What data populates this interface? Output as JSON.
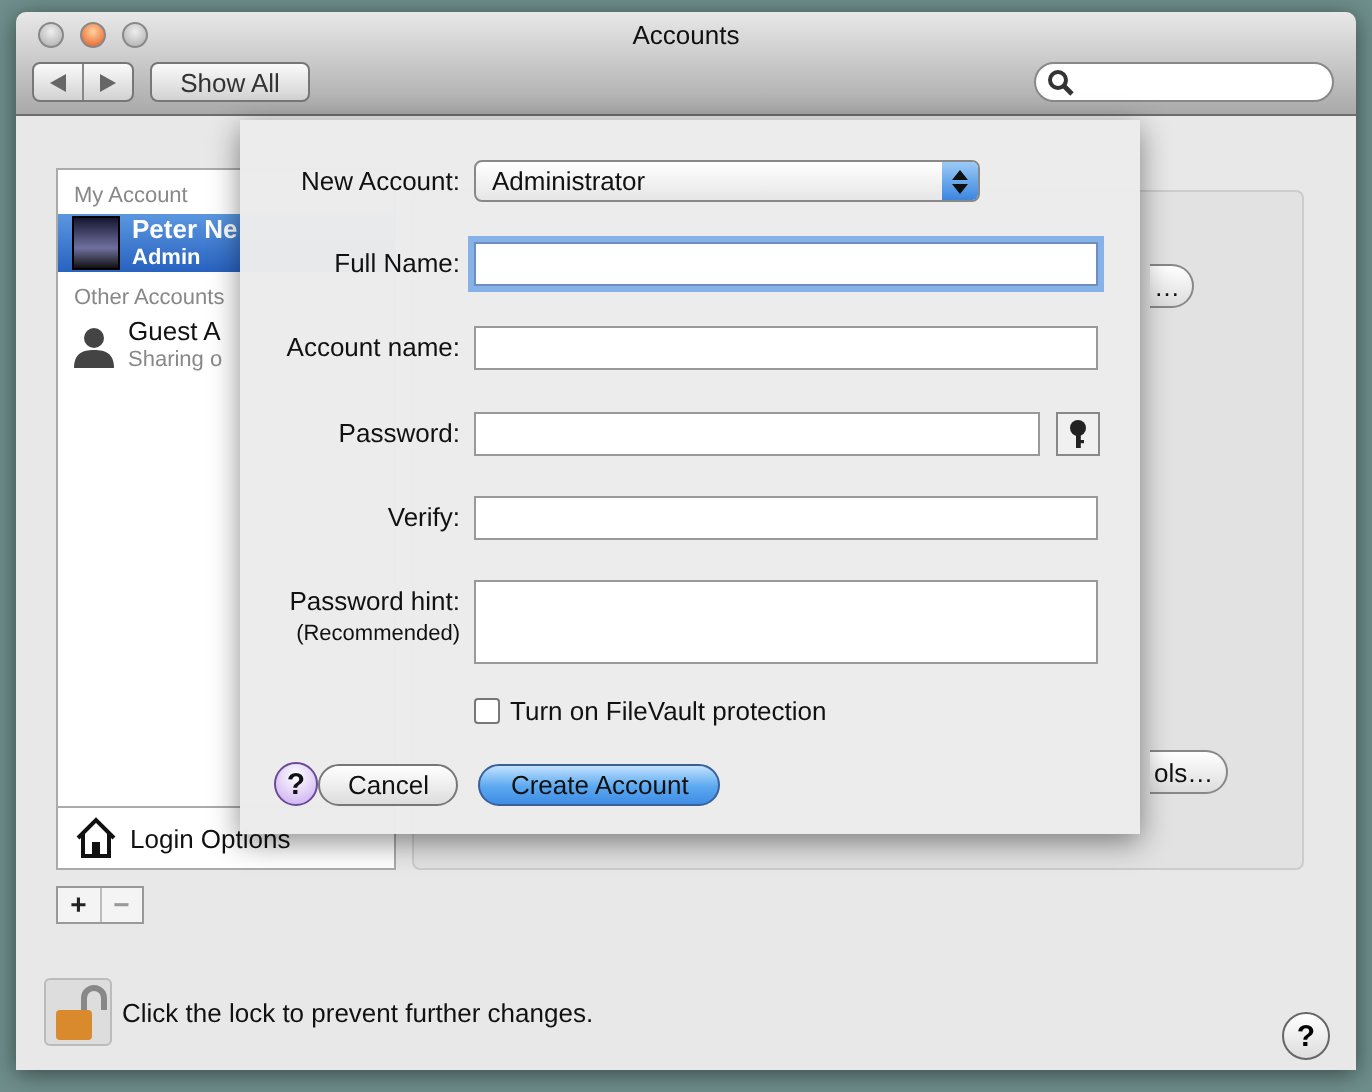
{
  "window": {
    "title": "Accounts",
    "show_all_button": "Show All"
  },
  "sidebar": {
    "sections": [
      {
        "header": "My Account",
        "items": [
          {
            "name": "Peter Ne",
            "role": "Admin",
            "kind": "photo",
            "selected": true
          }
        ]
      },
      {
        "header": "Other Accounts",
        "items": [
          {
            "name": "Guest A",
            "role": "Sharing o",
            "kind": "silhouette",
            "selected": false
          }
        ]
      }
    ],
    "login_options": "Login Options",
    "add_button": "+",
    "remove_button": "−"
  },
  "panel": {
    "peeking_buttons": [
      "…",
      "ols…"
    ]
  },
  "sheet": {
    "account_type": {
      "label": "New Account:",
      "value": "Administrator"
    },
    "fields": [
      {
        "label": "Full Name:",
        "kind": "text",
        "focused": true
      },
      {
        "label": "Account name:",
        "kind": "text",
        "focused": false
      },
      {
        "label": "Password:",
        "kind": "password",
        "focused": false
      },
      {
        "label": "Verify:",
        "kind": "text",
        "focused": false
      },
      {
        "label": "Password hint:",
        "sublabel": "(Recommended)",
        "kind": "multiline",
        "focused": false
      }
    ],
    "filevault": {
      "label": "Turn on FileVault protection",
      "checked": false
    },
    "help_button": "?",
    "buttons": [
      {
        "label": "Cancel",
        "default": false
      },
      {
        "label": "Create Account",
        "default": true
      }
    ]
  },
  "footer": {
    "lock_text": "Click the lock to prevent further changes.",
    "locked": false,
    "help_button": "?"
  }
}
